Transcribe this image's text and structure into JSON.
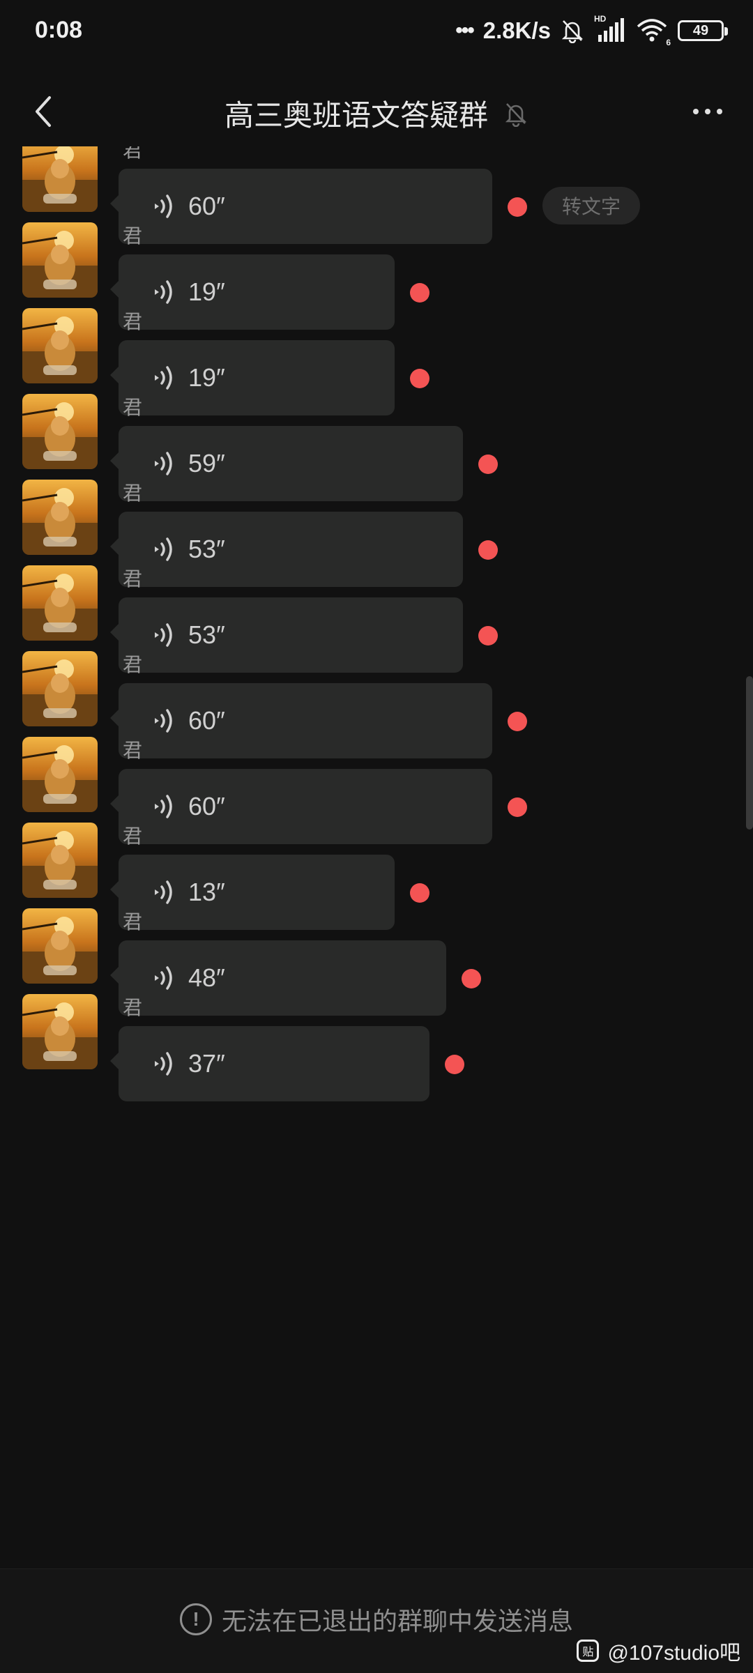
{
  "status_bar": {
    "time": "0:08",
    "network_speed": "2.8K/s",
    "hd_label": "HD",
    "wifi_sub": "6",
    "battery": "49"
  },
  "header": {
    "title": "高三奥班语文答疑群",
    "muted_icon": "bell-off-icon",
    "more_icon": "more-dots-icon",
    "back_icon": "chevron-left-icon"
  },
  "messages": [
    {
      "sender": "君",
      "duration": "60″",
      "convert_label": "转文字"
    },
    {
      "sender": "君",
      "duration": "19″"
    },
    {
      "sender": "君",
      "duration": "19″"
    },
    {
      "sender": "君",
      "duration": "59″"
    },
    {
      "sender": "君",
      "duration": "53″"
    },
    {
      "sender": "君",
      "duration": "53″"
    },
    {
      "sender": "君",
      "duration": "60″"
    },
    {
      "sender": "君",
      "duration": "60″"
    },
    {
      "sender": "君",
      "duration": "13″"
    },
    {
      "sender": "君",
      "duration": "48″"
    },
    {
      "sender": "君",
      "duration": "37″"
    }
  ],
  "footer": {
    "notice": "无法在已退出的群聊中发送消息",
    "notice_icon": "exclamation-circle-icon"
  },
  "watermark": {
    "badge": "贴",
    "text": "@107studio吧"
  },
  "colors": {
    "background": "#111111",
    "bubble": "#292a29",
    "unread_dot": "#f45454"
  }
}
